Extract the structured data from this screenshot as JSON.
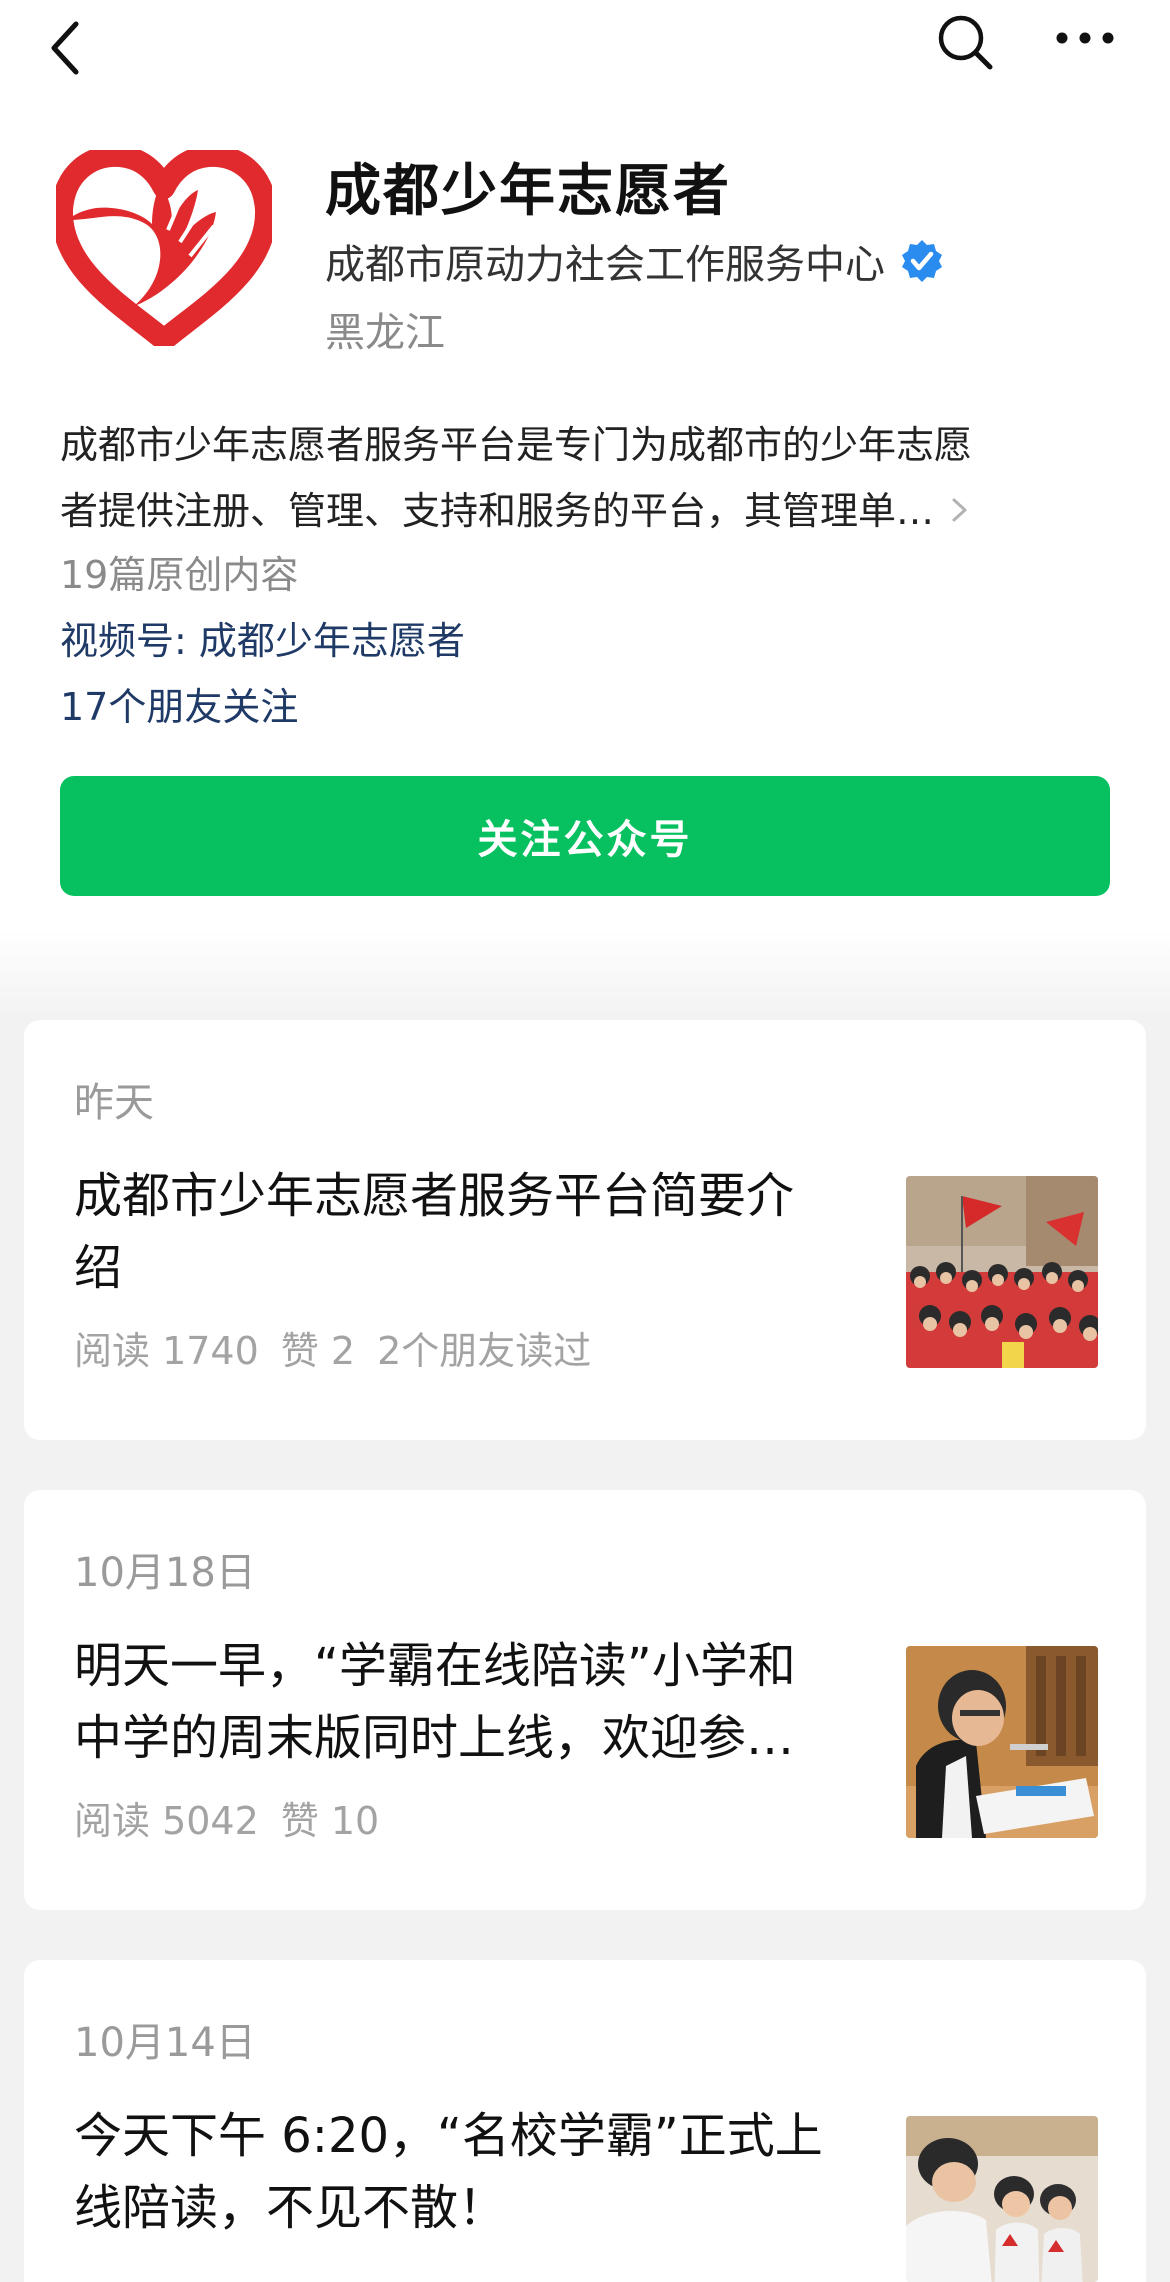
{
  "header": {
    "account_name": "成都少年志愿者",
    "organization": "成都市原动力社会工作服务中心",
    "region": "黑龙江",
    "intro_line1": "成都市少年志愿者服务平台是专门为成都市的少年志愿",
    "intro_line2": "者提供注册、管理、支持和服务的平台，其管理单…",
    "original_count": "19篇原创内容",
    "video_channel": "视频号: 成都少年志愿者",
    "friends_following": "17个朋友关注",
    "follow_button": "关注公众号"
  },
  "icons": {
    "back": "back-arrow-icon",
    "search": "search-icon",
    "more": "more-icon",
    "verified": "verified-badge-icon",
    "intro_expand": "chevron-right-icon"
  },
  "colors": {
    "accent_green": "#07c160",
    "link_blue": "#1f3a66",
    "verified_blue": "#2b8cf0",
    "logo_red": "#e02a2e"
  },
  "articles": [
    {
      "date": "昨天",
      "title_line1": "成都市少年志愿者服务平台简要介",
      "title_line2": "绍",
      "reads": "阅读 1740",
      "likes": "赞 2",
      "friends_read": "2个朋友读过"
    },
    {
      "date": "10月18日",
      "title_line1": "明天一早，“学霸在线陪读”小学和",
      "title_line2": "中学的周末版同时上线，欢迎参…",
      "reads": "阅读 5042",
      "likes": "赞 10"
    },
    {
      "date": "10月14日",
      "title_line1": "今天下午 6:20，“名校学霸”正式上",
      "title_line2": "线陪读，不见不散！"
    }
  ]
}
